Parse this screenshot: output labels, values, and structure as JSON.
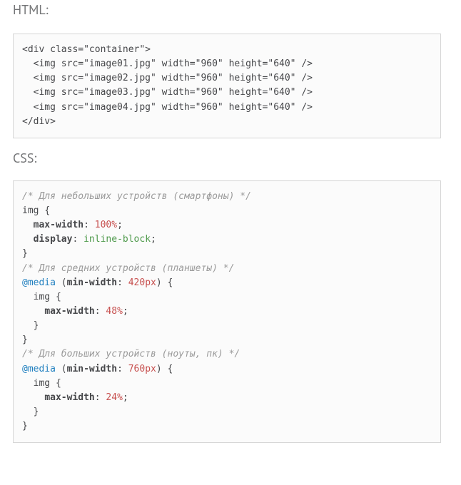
{
  "labels": {
    "html": "HTML:",
    "css": "CSS:"
  },
  "html_block": {
    "lines": [
      "<div class=\"container\">",
      "  <img src=\"image01.jpg\" width=\"960\" height=\"640\" />",
      "  <img src=\"image02.jpg\" width=\"960\" height=\"640\" />",
      "  <img src=\"image03.jpg\" width=\"960\" height=\"640\" />",
      "  <img src=\"image04.jpg\" width=\"960\" height=\"640\" />",
      "</div>"
    ]
  },
  "css_block": {
    "segments": [
      {
        "class": "c-cm",
        "text": "/* Для небольших устройств (смартфоны) */"
      },
      {
        "text": "\n"
      },
      {
        "class": "c-sel",
        "text": "img"
      },
      {
        "text": " "
      },
      {
        "class": "c-pn",
        "text": "{"
      },
      {
        "text": "\n  "
      },
      {
        "class": "c-prop",
        "text": "max-width"
      },
      {
        "class": "c-pn",
        "text": ":"
      },
      {
        "text": " "
      },
      {
        "class": "c-num",
        "text": "100%"
      },
      {
        "class": "c-pn",
        "text": ";"
      },
      {
        "text": "\n  "
      },
      {
        "class": "c-prop",
        "text": "display"
      },
      {
        "class": "c-pn",
        "text": ":"
      },
      {
        "text": " "
      },
      {
        "class": "c-val",
        "text": "inline-block"
      },
      {
        "class": "c-pn",
        "text": ";"
      },
      {
        "text": "\n"
      },
      {
        "class": "c-pn",
        "text": "}"
      },
      {
        "text": "\n"
      },
      {
        "class": "c-cm",
        "text": "/* Для средних устройств (планшеты) */"
      },
      {
        "text": "\n"
      },
      {
        "class": "c-kw",
        "text": "@media"
      },
      {
        "text": " ("
      },
      {
        "class": "c-prop",
        "text": "min-width"
      },
      {
        "class": "c-pn",
        "text": ":"
      },
      {
        "text": " "
      },
      {
        "class": "c-num",
        "text": "420px"
      },
      {
        "text": ") "
      },
      {
        "class": "c-pn",
        "text": "{"
      },
      {
        "text": "\n  "
      },
      {
        "class": "c-sel",
        "text": "img"
      },
      {
        "text": " "
      },
      {
        "class": "c-pn",
        "text": "{"
      },
      {
        "text": "\n    "
      },
      {
        "class": "c-prop",
        "text": "max-width"
      },
      {
        "class": "c-pn",
        "text": ":"
      },
      {
        "text": " "
      },
      {
        "class": "c-num",
        "text": "48%"
      },
      {
        "class": "c-pn",
        "text": ";"
      },
      {
        "text": "\n  "
      },
      {
        "class": "c-pn",
        "text": "}"
      },
      {
        "text": "\n"
      },
      {
        "class": "c-pn",
        "text": "}"
      },
      {
        "text": "\n"
      },
      {
        "class": "c-cm",
        "text": "/* Для больших устройств (ноуты, пк) */"
      },
      {
        "text": "\n"
      },
      {
        "class": "c-kw",
        "text": "@media"
      },
      {
        "text": " ("
      },
      {
        "class": "c-prop",
        "text": "min-width"
      },
      {
        "class": "c-pn",
        "text": ":"
      },
      {
        "text": " "
      },
      {
        "class": "c-num",
        "text": "760px"
      },
      {
        "text": ") "
      },
      {
        "class": "c-pn",
        "text": "{"
      },
      {
        "text": "\n  "
      },
      {
        "class": "c-sel",
        "text": "img"
      },
      {
        "text": " "
      },
      {
        "class": "c-pn",
        "text": "{"
      },
      {
        "text": "\n    "
      },
      {
        "class": "c-prop",
        "text": "max-width"
      },
      {
        "class": "c-pn",
        "text": ":"
      },
      {
        "text": " "
      },
      {
        "class": "c-num",
        "text": "24%"
      },
      {
        "class": "c-pn",
        "text": ";"
      },
      {
        "text": "\n  "
      },
      {
        "class": "c-pn",
        "text": "}"
      },
      {
        "text": "\n"
      },
      {
        "class": "c-pn",
        "text": "}"
      }
    ]
  }
}
